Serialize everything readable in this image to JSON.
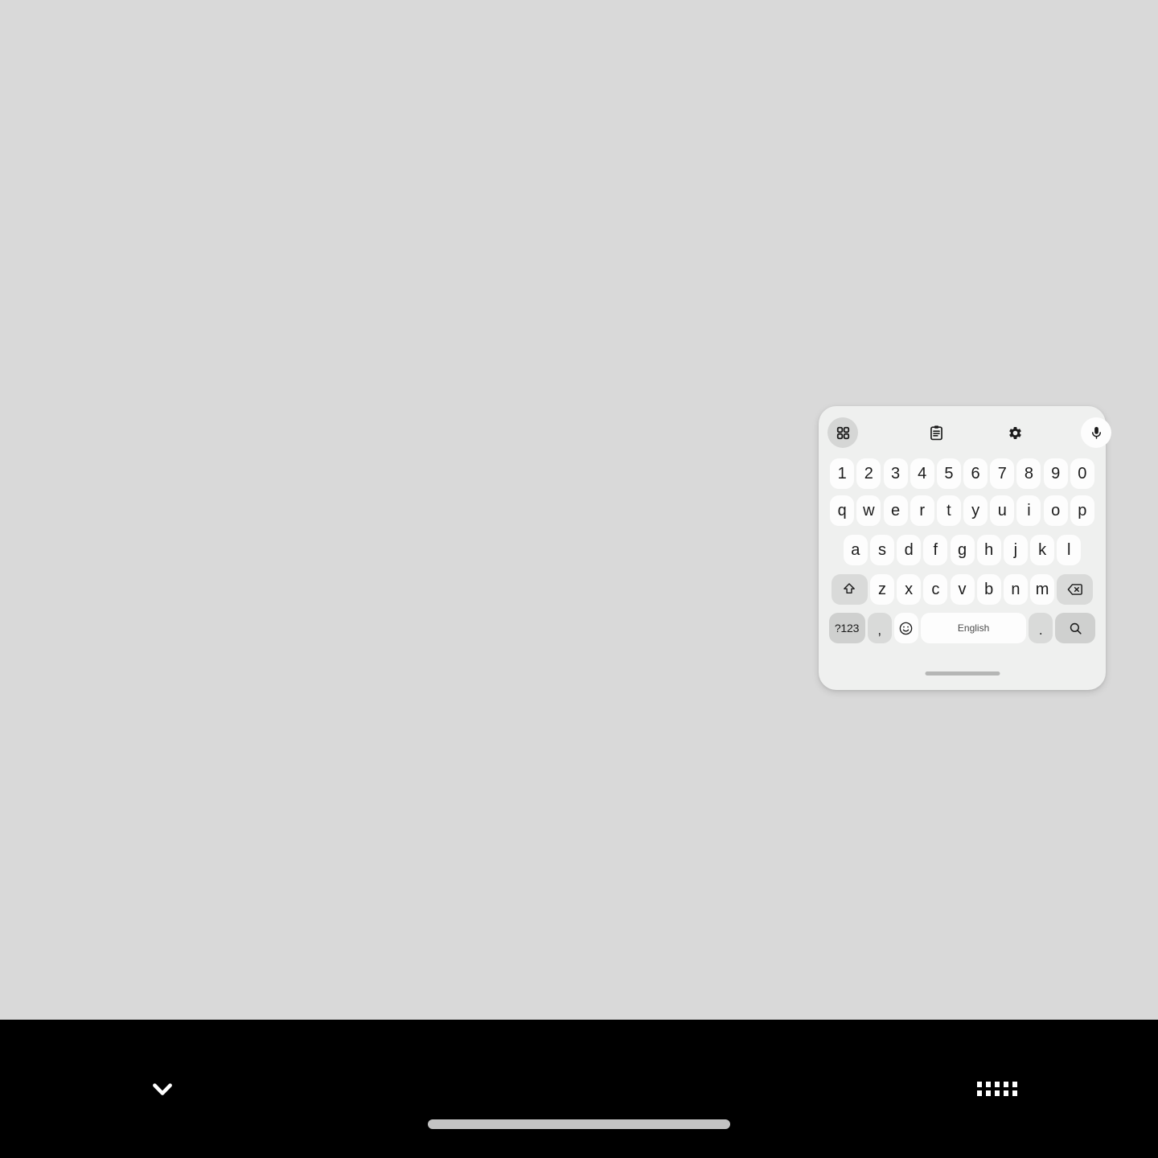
{
  "screen": {
    "background_color": "#d9d9d9",
    "nav_bar_color": "#000000"
  },
  "keyboard": {
    "panel_background": "#eff0ef",
    "key_background": "#fdfdfd",
    "modifier_key_background": "#d9dad9",
    "accent_key_background": "#cfd0cf",
    "toolbar": [
      {
        "name": "show-more-tools",
        "icon": "grid-2x2-icon",
        "style": "chip-gray"
      },
      {
        "name": "clipboard",
        "icon": "clipboard-icon",
        "style": "plain"
      },
      {
        "name": "settings",
        "icon": "gear-icon",
        "style": "plain"
      },
      {
        "name": "voice-input",
        "icon": "microphone-icon",
        "style": "chip-white"
      }
    ],
    "rows": {
      "numbers": [
        "1",
        "2",
        "3",
        "4",
        "5",
        "6",
        "7",
        "8",
        "9",
        "0"
      ],
      "top": [
        "q",
        "w",
        "e",
        "r",
        "t",
        "y",
        "u",
        "i",
        "o",
        "p"
      ],
      "home": [
        "a",
        "s",
        "d",
        "f",
        "g",
        "h",
        "j",
        "k",
        "l"
      ],
      "bottom_letters": [
        "z",
        "x",
        "c",
        "v",
        "b",
        "n",
        "m"
      ]
    },
    "shift_key": {
      "label": "",
      "icon": "shift-arrow-up-icon"
    },
    "backspace_key": {
      "label": "",
      "icon": "backspace-delete-icon"
    },
    "symbols_key": {
      "label": "?123"
    },
    "comma_key": {
      "label": ","
    },
    "emoji_key": {
      "label": "",
      "icon": "emoji-smiley-icon"
    },
    "space_key": {
      "label": "English"
    },
    "period_key": {
      "label": "."
    },
    "enter_key": {
      "label": "",
      "icon": "search-magnifier-icon"
    },
    "handle": {
      "name": "drag-handle"
    }
  },
  "nav_bar": {
    "back": {
      "name": "hide-keyboard-back",
      "icon": "chevron-down-icon"
    },
    "home": {
      "name": "home-gesture-pill"
    },
    "switcher": {
      "name": "keyboard-switcher",
      "icon": "keyboard-icon"
    }
  }
}
